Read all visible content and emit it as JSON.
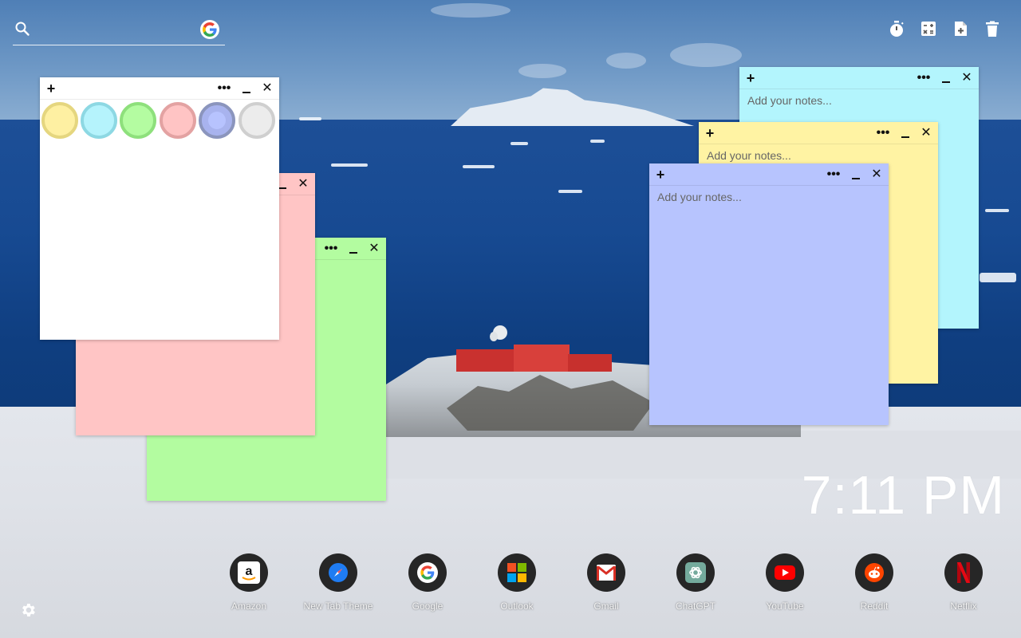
{
  "search": {
    "placeholder": "",
    "icon": "search-icon",
    "engine_icon": "google-g-icon"
  },
  "toolbar": {
    "items": [
      {
        "name": "timer",
        "icon": "stopwatch-icon"
      },
      {
        "name": "calculator",
        "icon": "calculator-icon"
      },
      {
        "name": "new-note",
        "icon": "add-note-icon"
      },
      {
        "name": "delete",
        "icon": "trash-icon"
      }
    ]
  },
  "notes": {
    "placeholder": "Add your notes...",
    "add_glyph": "+",
    "menu_glyph": "•••",
    "close_glyph": "✕",
    "colors": {
      "white": "#ffffff",
      "pink": "#ffc5c5",
      "green": "#b3fca0",
      "cyan": "#b3f5fd",
      "yellow": "#fff3a3",
      "blue": "#b7c4fe"
    },
    "color_picker": [
      "yellow",
      "cyan",
      "green",
      "pink",
      "blue",
      "white"
    ]
  },
  "clock": {
    "time": "7:11 PM"
  },
  "shortcuts": [
    {
      "label": "Amazon",
      "icon": "amazon-icon"
    },
    {
      "label": "New Tab Theme",
      "icon": "compass-icon"
    },
    {
      "label": "Google",
      "icon": "google-icon"
    },
    {
      "label": "Outlook",
      "icon": "microsoft-icon"
    },
    {
      "label": "Gmail",
      "icon": "gmail-icon"
    },
    {
      "label": "ChatGPT",
      "icon": "chatgpt-icon"
    },
    {
      "label": "YouTube",
      "icon": "youtube-icon"
    },
    {
      "label": "Reddit",
      "icon": "reddit-icon"
    },
    {
      "label": "Netflix",
      "icon": "netflix-icon"
    }
  ],
  "settings": {
    "icon": "gear-icon"
  }
}
